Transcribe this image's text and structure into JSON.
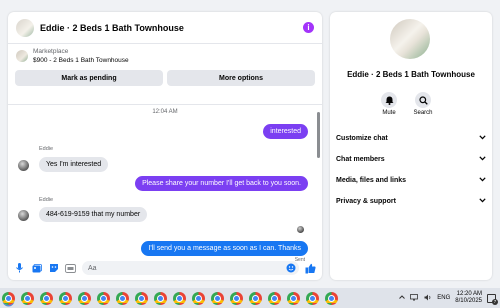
{
  "conversation": {
    "title": "Eddie · 2 Beds 1 Bath Townhouse",
    "info_icon": "info-icon",
    "accent_color": "#a334fa"
  },
  "listing": {
    "tag": "Marketplace",
    "price_line": "$900 - 2 Beds 1 Bath Townhouse"
  },
  "actions": {
    "mark_pending": "Mark as pending",
    "more_options": "More options"
  },
  "thread": {
    "timestamp": "12:04 AM",
    "messages": [
      {
        "direction": "out",
        "text": "interested"
      },
      {
        "direction": "in",
        "sender": "Eddie",
        "text": "Yes I'm interested"
      },
      {
        "direction": "out",
        "text": "Please share your number I'll get back to you soon."
      },
      {
        "direction": "in",
        "sender": "Eddie",
        "text": "484-619-9159 that my number"
      },
      {
        "direction": "out",
        "text": "I'll send you a message as soon as I can. Thanks"
      }
    ],
    "status": "Sent",
    "outgoing_color": "#7b3ff2",
    "outgoing_last_color": "#1877f2"
  },
  "composer": {
    "placeholder": "Aa",
    "icons": [
      "microphone-icon",
      "photo-icon",
      "sticker-icon",
      "gif-icon",
      "emoji-icon",
      "thumbs-up-icon"
    ]
  },
  "info_panel": {
    "title": "Eddie · 2 Beds 1 Bath Townhouse",
    "mute_label": "Mute",
    "search_label": "Search",
    "sections": [
      "Customize chat",
      "Chat members",
      "Media, files and links",
      "Privacy & support"
    ]
  },
  "taskbar": {
    "language": "ENG",
    "time": "12:20 AM",
    "date": "8/10/2025",
    "notification_count": "7"
  }
}
